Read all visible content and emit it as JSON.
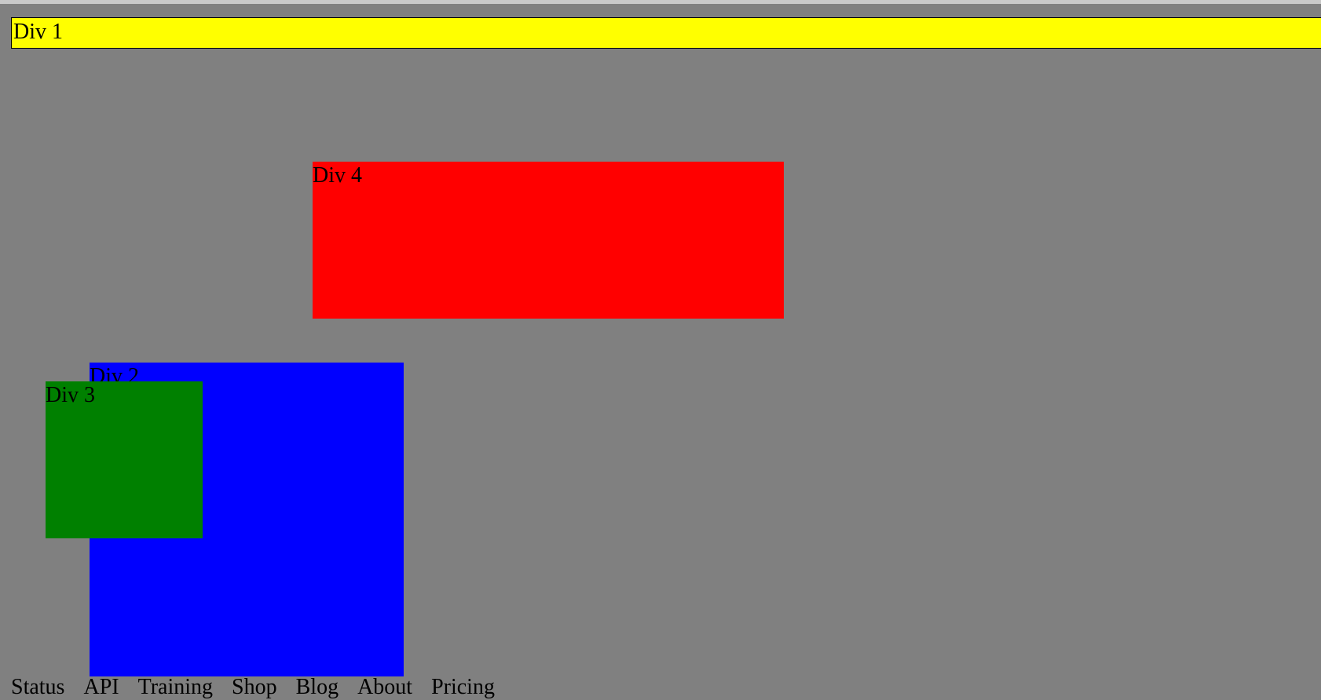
{
  "boxes": {
    "div1": {
      "label": "Div 1",
      "color": "#ffff00"
    },
    "div2": {
      "label": "Div 2",
      "color": "#0000ff"
    },
    "div3": {
      "label": "Div 3",
      "color": "#008000"
    },
    "div4": {
      "label": "Div 4",
      "color": "#ff0000"
    }
  },
  "page": {
    "background": "#808080"
  },
  "footer": {
    "links": [
      "Status",
      "API",
      "Training",
      "Shop",
      "Blog",
      "About",
      "Pricing"
    ]
  }
}
